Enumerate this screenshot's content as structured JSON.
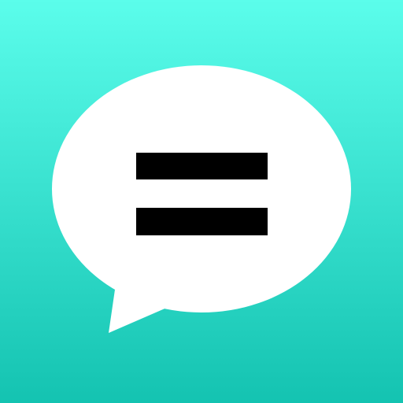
{
  "icon": {
    "name": "chat-bubble-equals-icon",
    "colors": {
      "background_top": "#5BFDEB",
      "background_bottom": "#14C3B1",
      "bubble": "#FFFFFF",
      "bars": "#000000"
    }
  }
}
